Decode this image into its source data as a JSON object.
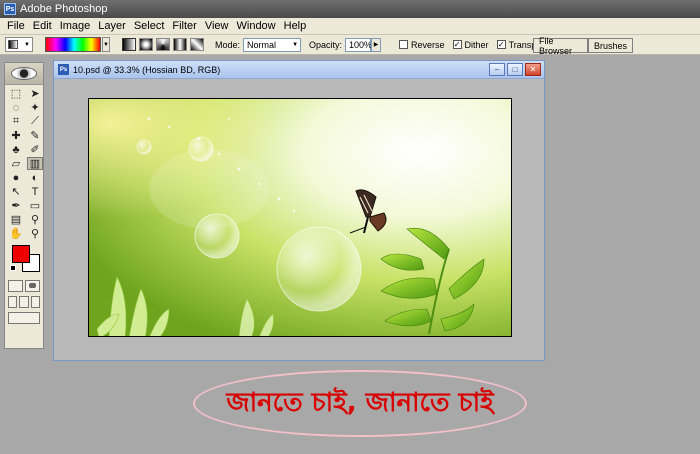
{
  "window": {
    "title": "Adobe Photoshop",
    "app_icon": "Ps"
  },
  "menu": [
    "File",
    "Edit",
    "Image",
    "Layer",
    "Select",
    "Filter",
    "View",
    "Window",
    "Help"
  ],
  "options": {
    "mode_label": "Mode:",
    "mode_value": "Normal",
    "opacity_label": "Opacity:",
    "opacity_value": "100%",
    "reverse_label": "Reverse",
    "dither_label": "Dither",
    "transparency_label": "Transparency",
    "reverse_checked": false,
    "dither_checked": true,
    "transparency_checked": true
  },
  "palette_well": {
    "file_browser": "File Browser",
    "brushes": "Brushes"
  },
  "toolbox": {
    "tools": [
      "marquee-icon",
      "move-icon",
      "lasso-icon",
      "magic-wand-icon",
      "crop-icon",
      "slice-icon",
      "healing-brush-icon",
      "brush-icon",
      "clone-stamp-icon",
      "history-brush-icon",
      "eraser-icon",
      "gradient-icon",
      "blur-icon",
      "dodge-icon",
      "path-selection-icon",
      "type-icon",
      "pen-icon",
      "shape-icon",
      "notes-icon",
      "eyedropper-icon",
      "hand-icon",
      "zoom-icon"
    ],
    "active_tool": "gradient-icon",
    "foreground_color": "#ee0000",
    "background_color": "#ffffff"
  },
  "document": {
    "title": "10.psd @ 33.3% (Hossian BD, RGB)"
  },
  "caption": {
    "text": "জানতে চাই, জানাতে চাই",
    "color": "#d80000"
  }
}
